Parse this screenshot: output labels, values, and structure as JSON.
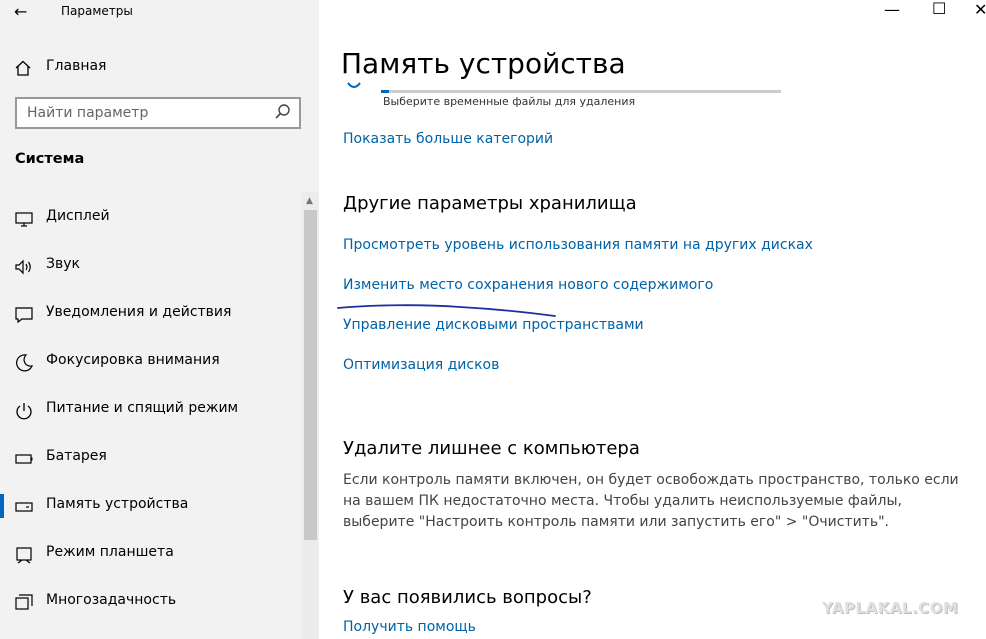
{
  "window": {
    "app_title": "Параметры"
  },
  "sidebar": {
    "home_label": "Главная",
    "search_placeholder": "Найти параметр",
    "section_title": "Система",
    "items": [
      {
        "label": "Дисплей",
        "icon": "display-icon"
      },
      {
        "label": "Звук",
        "icon": "speaker-icon"
      },
      {
        "label": "Уведомления и действия",
        "icon": "notification-icon"
      },
      {
        "label": "Фокусировка внимания",
        "icon": "moon-icon"
      },
      {
        "label": "Питание и спящий режим",
        "icon": "power-icon"
      },
      {
        "label": "Батарея",
        "icon": "battery-icon"
      },
      {
        "label": "Память устройства",
        "icon": "storage-icon",
        "selected": true
      },
      {
        "label": "Режим планшета",
        "icon": "tablet-icon"
      },
      {
        "label": "Многозадачность",
        "icon": "multitask-icon"
      }
    ]
  },
  "main": {
    "title": "Память устройства",
    "temp_files_caption": "Выберите временные файлы для удаления",
    "show_more_link": "Показать больше категорий",
    "other_settings": {
      "heading": "Другие параметры хранилища",
      "links": [
        "Просмотреть уровень использования памяти на других дисках",
        "Изменить место сохранения нового содержимого",
        "Управление дисковыми пространствами",
        "Оптимизация дисков"
      ]
    },
    "cleanup": {
      "heading": "Удалите лишнее с компьютера",
      "text": "Если контроль памяти включен, он будет освобождать пространство, только если на вашем ПК недостаточно места. Чтобы удалить неиспользуемые файлы, выберите \"Настроить контроль памяти или запустить его\" > \"Очистить\"."
    },
    "questions": {
      "heading": "У вас появились вопросы?",
      "help_link": "Получить помощь"
    }
  },
  "watermark": "YAPLAKAL.COM",
  "colors": {
    "accent": "#0067c0",
    "link": "#0062a8",
    "sidebar_bg": "#f2f2f2",
    "annotation": "#1a2fa0"
  }
}
